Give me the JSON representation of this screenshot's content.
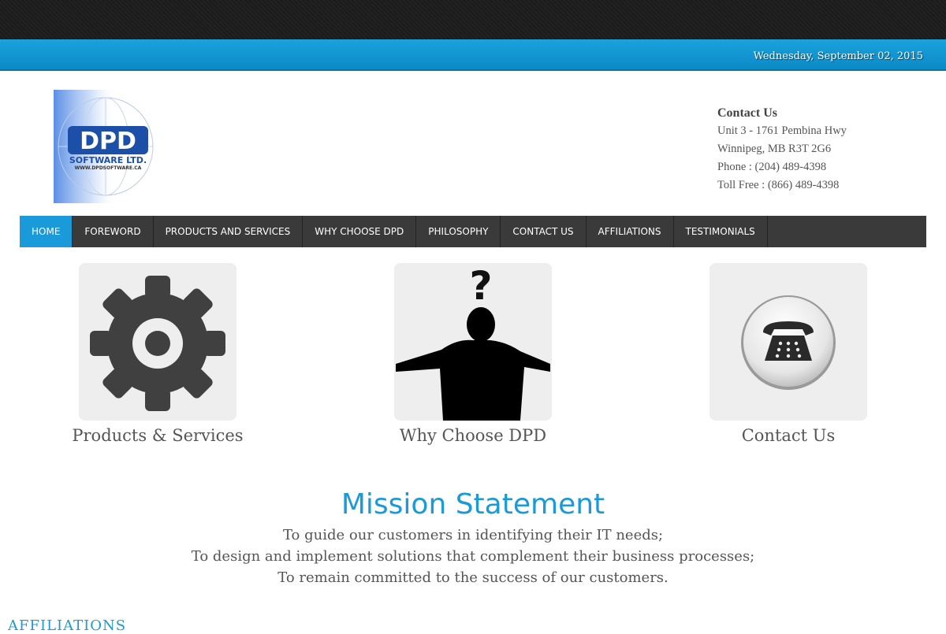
{
  "header": {
    "date": "Wednesday, September 02, 2015"
  },
  "logo": {
    "brand": "DPD",
    "subtitle": "SOFTWARE LTD.",
    "url": "WWW.DPDSOFTWARE.CA"
  },
  "contact": {
    "heading": "Contact Us",
    "address1": "Unit 3 - 1761 Pembina Hwy",
    "address2": "Winnipeg, MB R3T 2G6",
    "phone": "Phone : (204) 489-4398",
    "tollfree": "Toll Free : (866) 489-4398"
  },
  "nav": {
    "items": [
      {
        "label": "HOME",
        "active": true
      },
      {
        "label": "FOREWORD"
      },
      {
        "label": "PRODUCTS AND SERVICES"
      },
      {
        "label": "WHY CHOOSE DPD"
      },
      {
        "label": "PHILOSOPHY"
      },
      {
        "label": "CONTACT US"
      },
      {
        "label": "AFFILIATIONS"
      },
      {
        "label": "TESTIMONIALS"
      }
    ]
  },
  "features": {
    "products": {
      "label": "Products & Services",
      "icon": "gear-icon"
    },
    "why": {
      "label": "Why Choose DPD",
      "icon": "question-person-icon"
    },
    "contact": {
      "label": "Contact Us",
      "icon": "telephone-icon"
    }
  },
  "mission": {
    "title": "Mission Statement",
    "line1": "To guide our customers in identifying their IT needs;",
    "line2": "To design and implement solutions that complement their business processes;",
    "line3": "To remain committed to the success of our customers."
  },
  "affiliations": {
    "heading": "AFFILIATIONS"
  },
  "colors": {
    "accent": "#1a9ad8",
    "nav_bg": "#3a3a3a",
    "top_bg": "#1f1f1f"
  }
}
